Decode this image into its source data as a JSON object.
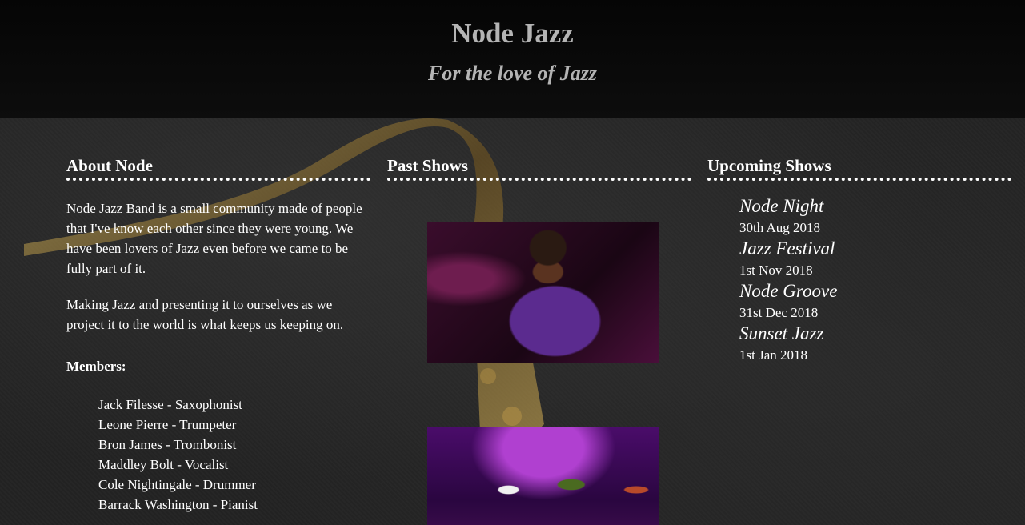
{
  "header": {
    "title": "Node Jazz",
    "tagline": "For the love of Jazz"
  },
  "about": {
    "heading": "About Node",
    "paragraph1": "Node Jazz Band is a small community made of people that I've know each other since they were young. We have been lovers of Jazz even before we came to be fully part of it.",
    "paragraph2": "Making Jazz and presenting it to ourselves as we project it to the world is what keeps us keeping on.",
    "members_label": "Members:",
    "members": [
      "Jack Filesse - Saxophonist",
      "Leone Pierre - Trumpeter",
      "Bron James - Trombonist",
      "Maddley Bolt - Vocalist",
      "Cole Nightingale - Drummer",
      "Barrack Washington - Pianist"
    ]
  },
  "past_shows": {
    "heading": "Past Shows"
  },
  "upcoming": {
    "heading": "Upcoming Shows",
    "shows": [
      {
        "name": "Node Night",
        "date": "30th Aug 2018"
      },
      {
        "name": "Jazz Festival",
        "date": "1st Nov 2018"
      },
      {
        "name": "Node Groove",
        "date": "31st Dec 2018"
      },
      {
        "name": "Sunset Jazz",
        "date": "1st Jan 2018"
      }
    ]
  },
  "colors": {
    "header_text": "#b4b4b4",
    "body_text": "#ffffff",
    "header_bg": "#0a0a0a"
  }
}
